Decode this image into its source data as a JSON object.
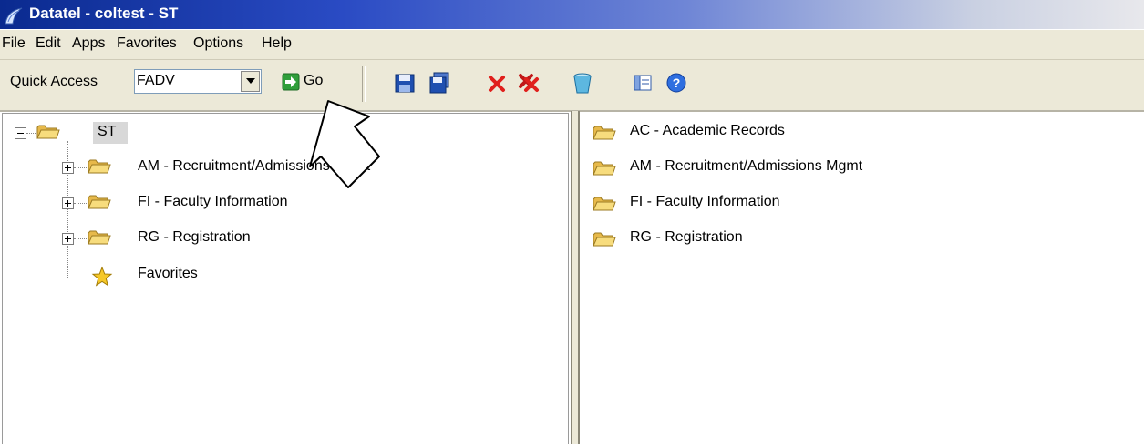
{
  "window": {
    "title": "Datatel - coltest - ST"
  },
  "menu": {
    "items": [
      "File",
      "Edit",
      "Apps",
      "Favorites",
      "Options",
      "Help"
    ]
  },
  "toolbar": {
    "quick_access_label": "Quick Access",
    "quick_access_value": "FADV",
    "go_label": "Go",
    "icons": [
      "save-icon",
      "save-all-icon",
      "cancel-icon",
      "cancel-all-icon",
      "clear-icon",
      "view-icon",
      "help-icon"
    ]
  },
  "left_tree": {
    "root": "ST",
    "items": [
      {
        "label": "AM - Recruitment/Admissions Mgmt"
      },
      {
        "label": "FI - Faculty Information"
      },
      {
        "label": "RG - Registration"
      },
      {
        "label": "Favorites"
      }
    ]
  },
  "right_list": {
    "items": [
      "AC - Academic Records",
      "AM - Recruitment/Admissions Mgmt",
      "FI - Faculty Information",
      "RG - Registration"
    ]
  },
  "colors": {
    "title_bar": "#0a2a8f",
    "chrome": "#ece9d8",
    "folder": "#f2d26c"
  }
}
